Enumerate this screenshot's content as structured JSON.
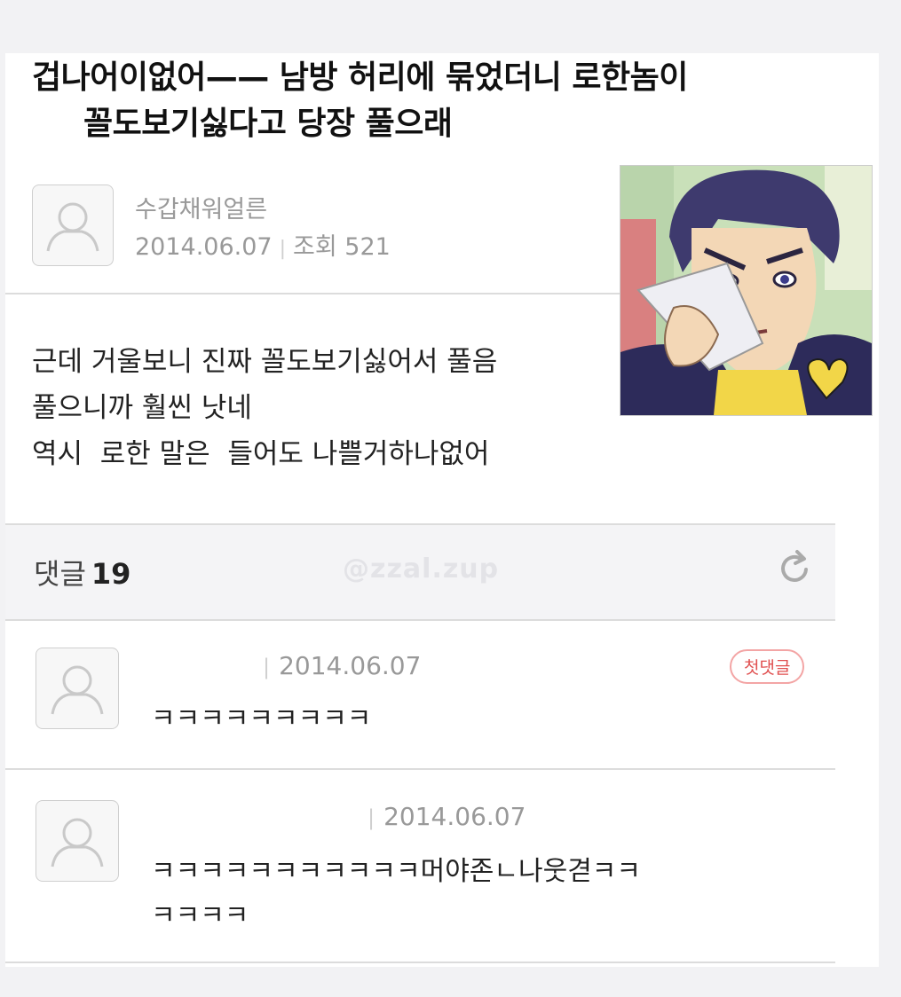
{
  "post": {
    "title_line1": "겁나어이없어—— 남방 허리에 묶었더니 로한놈이",
    "title_line2": "꼴도보기싫다고 당장 풀으래",
    "author": "수갑채워얼른",
    "date": "2014.06.07",
    "views_label": "조회 521",
    "body": [
      "근데 거울보니 진짜 꼴도보기싫어서 풀음",
      "풀으니까 훨씬 낫네",
      "역시  로한 말은  들어도 나쁠거하나없어"
    ]
  },
  "comments_header": {
    "label": "댓글",
    "count": "19",
    "watermark": "@zzal.zup"
  },
  "comments": [
    {
      "date": "2014.06.07",
      "text": "ㅋㅋㅋㅋㅋㅋㅋㅋㅋ",
      "badge": "첫댓글"
    },
    {
      "date": "2014.06.07",
      "text_line1": "ㅋㅋㅋㅋㅋㅋㅋㅋㅋㅋㅋ머야존ㄴ나웃겯ㅋㅋ",
      "text_line2": "ㅋㅋㅋㅋ"
    }
  ],
  "icons": {
    "avatar": "default-user-avatar-icon",
    "refresh": "refresh-icon"
  }
}
